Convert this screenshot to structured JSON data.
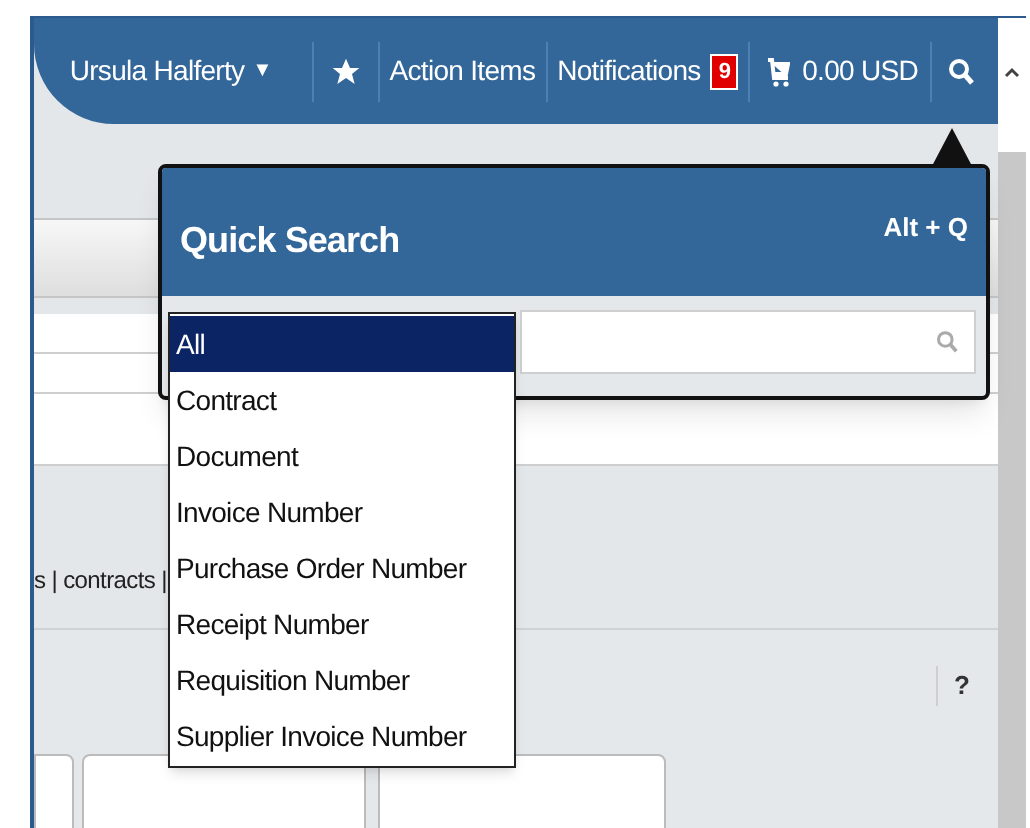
{
  "header": {
    "user_menu": "Ursula Halferty",
    "user_caret": "▼",
    "action_items": "Action Items",
    "notifications": {
      "label": "Notifications",
      "count": "9"
    },
    "cart_total": "0.00 USD"
  },
  "page": {
    "breadcrumb": "s | contracts |",
    "help": "?"
  },
  "quick_search": {
    "title": "Quick Search",
    "shortcut": "Alt + Q",
    "scope_options": [
      {
        "label": "All",
        "selected": true
      },
      {
        "label": "Contract",
        "selected": false
      },
      {
        "label": "Document",
        "selected": false
      },
      {
        "label": "Invoice Number",
        "selected": false
      },
      {
        "label": "Purchase Order Number",
        "selected": false
      },
      {
        "label": "Receipt Number",
        "selected": false
      },
      {
        "label": "Requisition Number",
        "selected": false
      },
      {
        "label": "Supplier Invoice Number",
        "selected": false
      }
    ]
  }
}
